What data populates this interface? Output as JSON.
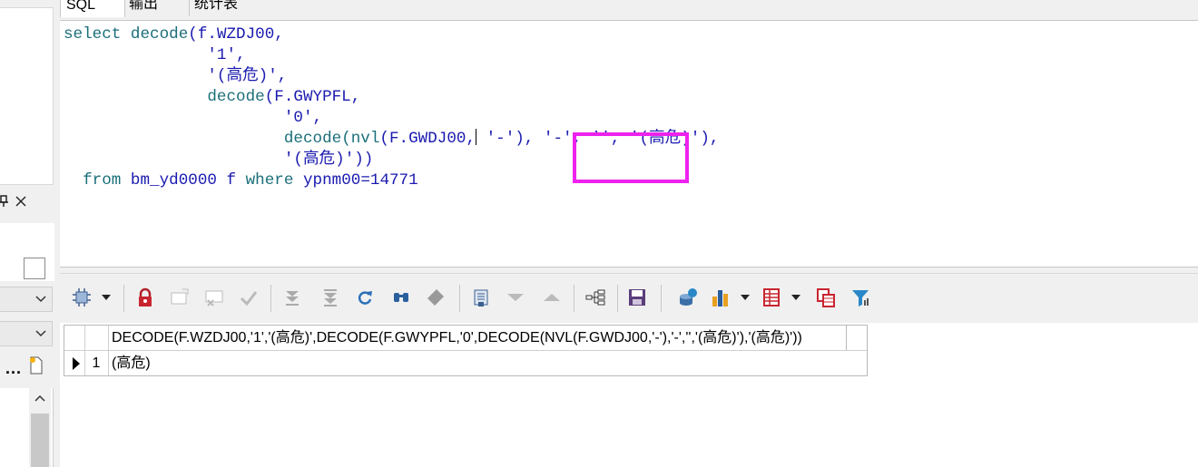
{
  "tabs": [
    {
      "label": "SQL",
      "active": true
    },
    {
      "label": "输出",
      "active": false
    },
    {
      "label": "统计表",
      "active": false
    }
  ],
  "editor": {
    "lines": [
      [
        {
          "t": "select decode",
          "c": "kw"
        },
        {
          "t": "(f.WZDJ00,"
        }
      ],
      [
        {
          "t": "               '1',"
        }
      ],
      [
        {
          "t": "               '(高危)',"
        }
      ],
      [
        {
          "t": "               decode",
          "c": "kw"
        },
        {
          "t": "(F.GWYPFL,"
        }
      ],
      [
        {
          "t": "                       '0',"
        }
      ],
      [
        {
          "t": "                       decode",
          "c": "kw"
        },
        {
          "t": "(nvl",
          "c": "kw"
        },
        {
          "t": "(F.GWDJ00,"
        },
        {
          "caret": true
        },
        {
          "t": " '-'), '-', '', '(高危)'),"
        }
      ],
      [
        {
          "t": "                       '(高危)'))"
        }
      ],
      [
        {
          "t": "  from",
          "c": "kw"
        },
        {
          "t": " bm_yd0000 f "
        },
        {
          "t": "where",
          "c": "kw"
        },
        {
          "t": " ypnm00=14771"
        }
      ]
    ],
    "highlight_color": "#ee22ee"
  },
  "toolbar": {
    "icons": [
      "query-options-icon",
      "lock-icon",
      "new-record-icon",
      "cancel-record-icon",
      "post-record-icon",
      "move-last-icon",
      "move-next-icon",
      "refresh-icon",
      "find-icon",
      "clear-icon",
      "record-viewer-icon",
      "move-down-icon",
      "move-up-icon",
      "tree-view-icon",
      "save-icon",
      "export-db-icon",
      "chart-icon",
      "grid-icon",
      "copy-grid-icon",
      "filter-icon"
    ]
  },
  "grid": {
    "column_header": "DECODE(F.WZDJ00,'1','(高危)',DECODE(F.GWYPFL,'0',DECODE(NVL(F.GWDJ00,'-'),'-','','(高危)'),'(高危)'))",
    "rows": [
      {
        "num": "1",
        "value": "(高危)"
      }
    ]
  },
  "left_panel": {
    "pin_glyph": "⊓",
    "close_glyph": "✕",
    "chevron": "⌄",
    "dots": "...",
    "up_arrow": "^"
  }
}
